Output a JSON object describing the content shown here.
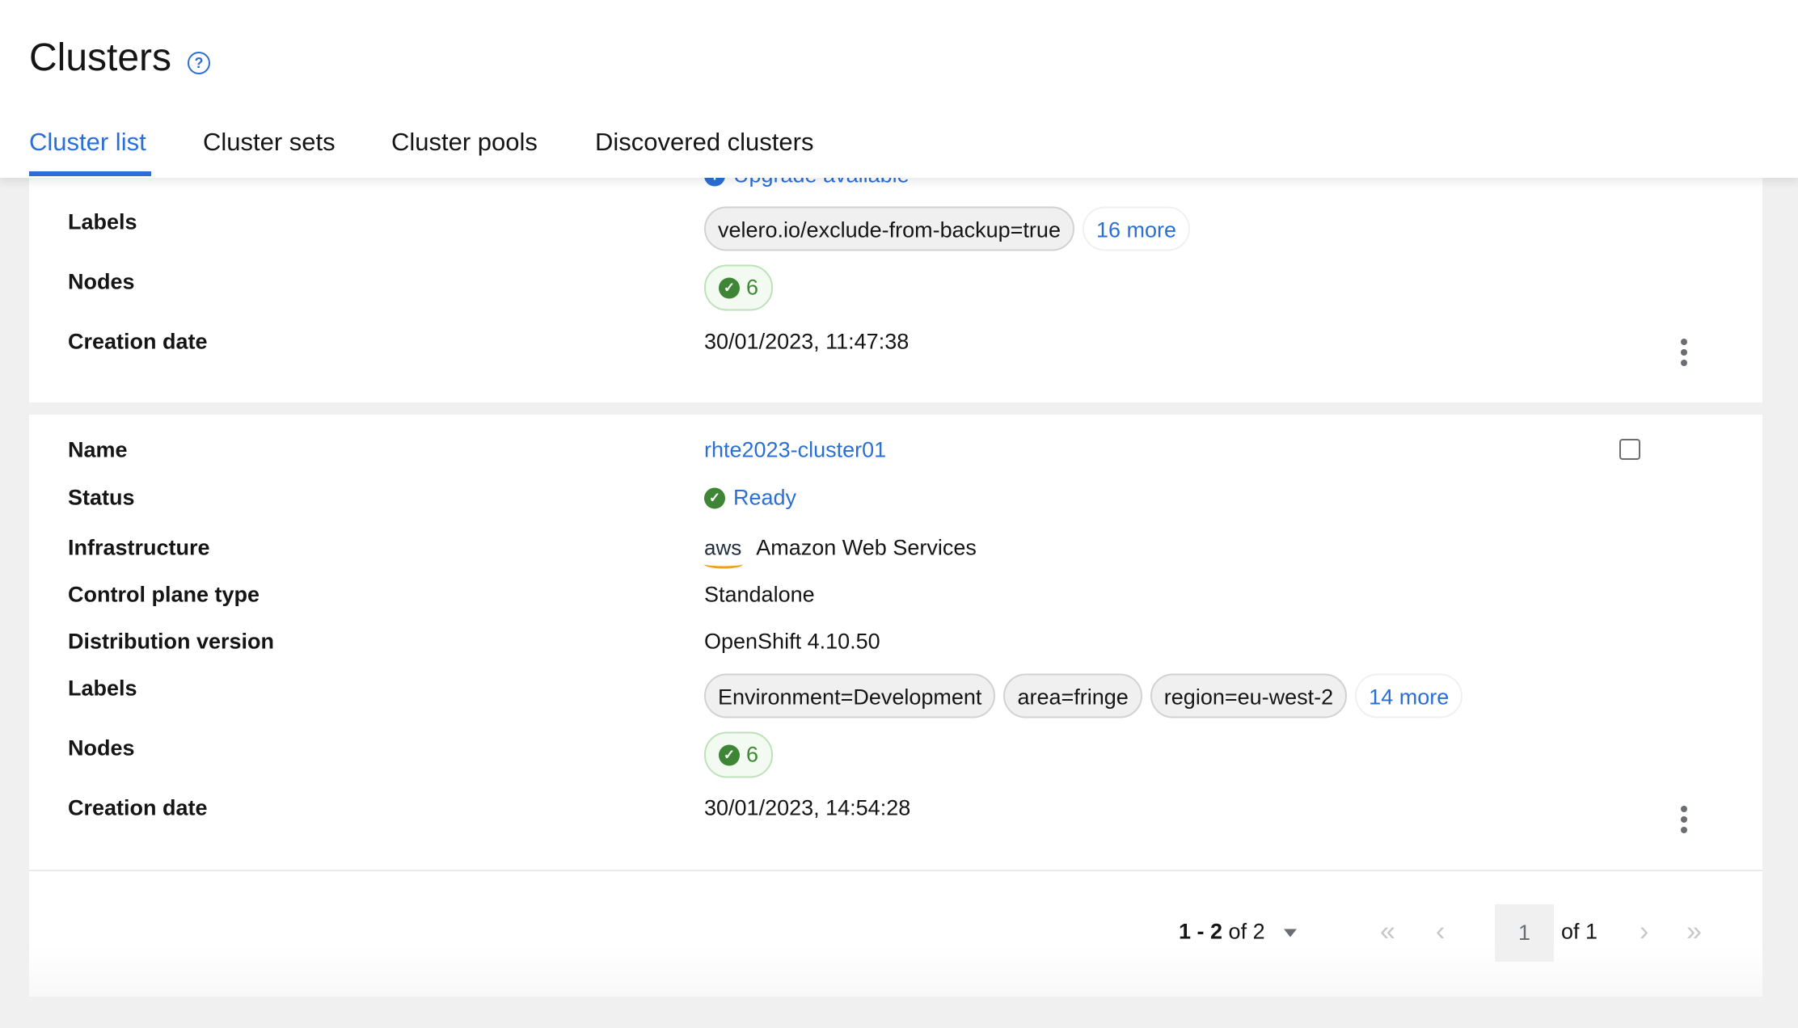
{
  "page": {
    "title": "Clusters",
    "help_icon": "question-circle-icon"
  },
  "tabs": [
    {
      "label": "Cluster list",
      "active": true
    },
    {
      "label": "Cluster sets",
      "active": false
    },
    {
      "label": "Cluster pools",
      "active": false
    },
    {
      "label": "Discovered clusters",
      "active": false
    }
  ],
  "clusters": [
    {
      "upgrade": "Upgrade available",
      "labels_title": "Labels",
      "labels": [
        "velero.io/exclude-from-backup=true"
      ],
      "more_labels": "16 more",
      "nodes_title": "Nodes",
      "nodes": "6",
      "creation_title": "Creation date",
      "creation_date": "30/01/2023, 11:47:38"
    },
    {
      "name_title": "Name",
      "name": "rhte2023-cluster01",
      "status_title": "Status",
      "status": "Ready",
      "infra_title": "Infrastructure",
      "infra_logo": "aws",
      "infra": "Amazon Web Services",
      "control_title": "Control plane type",
      "control": "Standalone",
      "dist_title": "Distribution version",
      "dist": "OpenShift 4.10.50",
      "labels_title": "Labels",
      "labels": [
        "Environment=Development",
        "area=fringe",
        "region=eu-west-2"
      ],
      "more_labels": "14 more",
      "nodes_title": "Nodes",
      "nodes": "6",
      "creation_title": "Creation date",
      "creation_date": "30/01/2023, 14:54:28"
    }
  ],
  "pagination": {
    "range": "1 - 2",
    "of_total": "of 2",
    "page": "1",
    "of_pages": "of 1"
  },
  "colors": {
    "accent": "#2b6fd6",
    "success": "#3e8635"
  }
}
